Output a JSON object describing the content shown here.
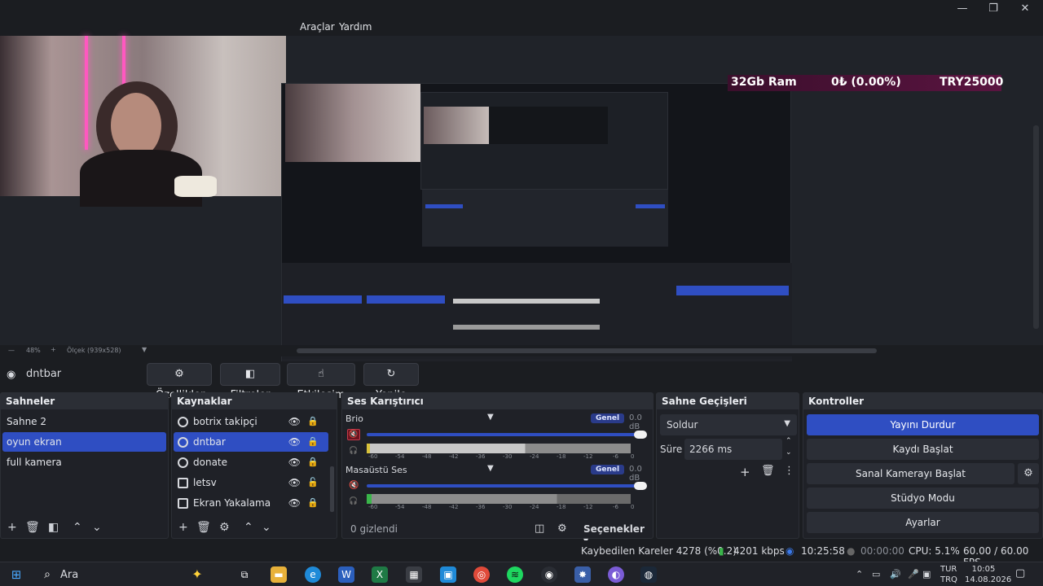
{
  "window": {
    "minimize": "—",
    "maximize": "❐",
    "close": "✕"
  },
  "menu": {
    "items": [
      "Araçlar",
      "Yardım"
    ]
  },
  "ticker": {
    "ram": "32Gb Ram",
    "donation": "0₺ (0.00%)",
    "goal": "TRY25000"
  },
  "preview_status": {
    "zoom": "48%",
    "scale": "Ölçek (939x528)"
  },
  "source_bar": {
    "current_source": "dntbar",
    "buttons": {
      "properties": "Özellikler",
      "filters": "Filtreler",
      "interact": "Etkileşim",
      "refresh": "Yenile"
    }
  },
  "scenes": {
    "title": "Sahneler",
    "items": [
      "Sahne 2",
      "oyun ekran",
      "full kamera"
    ],
    "selected": 1
  },
  "sources": {
    "title": "Kaynaklar",
    "items": [
      {
        "name": "botrix takipçi",
        "icon": "globe-icon"
      },
      {
        "name": "dntbar",
        "icon": "globe-icon"
      },
      {
        "name": "donate",
        "icon": "globe-icon"
      },
      {
        "name": "letsv",
        "icon": "window-icon"
      },
      {
        "name": "Ekran Yakalama",
        "icon": "monitor-icon"
      }
    ],
    "selected": 1
  },
  "mixer": {
    "title": "Ses Karıştırıcı",
    "channels": [
      {
        "name": "Brio",
        "mode": "Genel",
        "db": "0.0 dB",
        "muted": true
      },
      {
        "name": "Masaüstü Ses",
        "mode": "Genel",
        "db": "0.0 dB",
        "muted": true
      }
    ],
    "scale": [
      "-60",
      "-54",
      "-48",
      "-42",
      "-36",
      "-30",
      "-24",
      "-18",
      "-12",
      "-6",
      "0"
    ],
    "hidden": "0 gizlendi",
    "options": "Seçenekler"
  },
  "transitions": {
    "title": "Sahne Geçişleri",
    "type": "Soldur",
    "duration_label": "Süre",
    "duration": "2266 ms"
  },
  "controls": {
    "title": "Kontroller",
    "buttons": [
      "Yayını Durdur",
      "Kaydı Başlat",
      "Sanal Kamerayı Başlat",
      "Stüdyo Modu",
      "Ayarlar"
    ]
  },
  "status": {
    "dropped": "Kaybedilen Kareler 4278 (%0.2)",
    "bitrate": "4201 kbps",
    "live_time": "10:25:58",
    "rec_time": "00:00:00",
    "cpu": "CPU: 5.1%",
    "fps": "60.00 / 60.00 FPS"
  },
  "taskbar": {
    "search": "Ara",
    "lang1": "TUR",
    "lang2": "TRQ",
    "time": "10:05",
    "date": "14.08.2026"
  },
  "colors": {
    "accent": "#2f4ec2",
    "panel": "#1f2127",
    "bg": "#1b1d21",
    "ticker": "#5a1440"
  }
}
